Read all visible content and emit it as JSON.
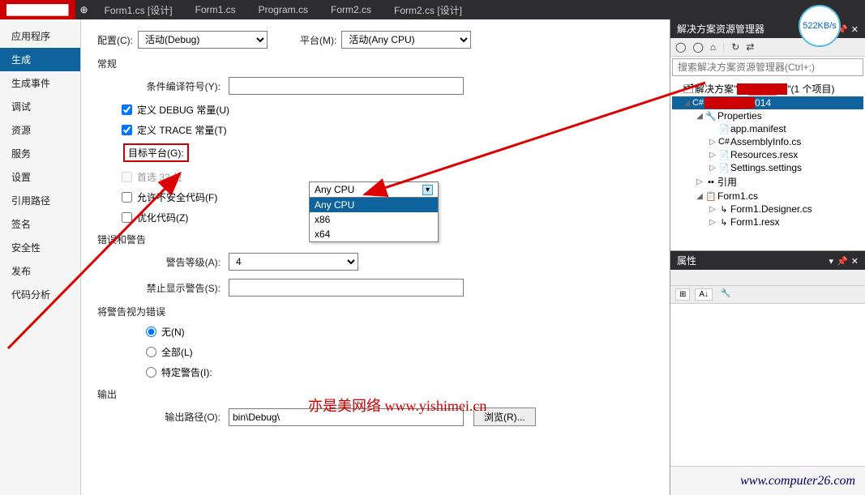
{
  "tabs": {
    "pinned_redacted": "█████████",
    "items": [
      "Form1.cs [设计]",
      "Form1.cs",
      "Program.cs",
      "Form2.cs",
      "Form2.cs [设计]"
    ]
  },
  "sidebar": {
    "items": [
      "应用程序",
      "生成",
      "生成事件",
      "调试",
      "资源",
      "服务",
      "设置",
      "引用路径",
      "签名",
      "安全性",
      "发布",
      "代码分析"
    ],
    "selected_index": 1
  },
  "config": {
    "config_label": "配置(C):",
    "config_value": "活动(Debug)",
    "platform_label": "平台(M):",
    "platform_value": "活动(Any CPU)"
  },
  "general": {
    "header": "常规",
    "cond_symbol_label": "条件编译符号(Y):",
    "cond_symbol_value": "",
    "define_debug": "定义 DEBUG 常量(U)",
    "define_trace": "定义 TRACE 常量(T)",
    "target_platform_label": "目标平台(G):",
    "target_platform_value": "Any CPU",
    "target_options": [
      "Any CPU",
      "x86",
      "x64"
    ],
    "prefer32_label": "首选 32 位",
    "unsafe_label": "允许不安全代码(F)",
    "optimize_label": "优化代码(Z)"
  },
  "warnings": {
    "header": "错误和警告",
    "level_label": "警告等级(A):",
    "level_value": "4",
    "suppress_label": "禁止显示警告(S):",
    "suppress_value": ""
  },
  "treat_as_error": {
    "header": "将警告视为错误",
    "none": "无(N)",
    "all": "全部(L)",
    "specific": "特定警告(I):"
  },
  "output": {
    "header": "输出",
    "path_label": "输出路径(O):",
    "path_value": "bin\\Debug\\",
    "browse": "浏览(R)..."
  },
  "solution_explorer": {
    "title": "解决方案资源管理器",
    "search_placeholder": "搜索解决方案资源管理器(Ctrl+;)",
    "solution_prefix": "解决方案\"",
    "solution_redacted": "████",
    "solution_suffix": "\"(1 个项目)",
    "proj_redacted": "████",
    "proj_suffix": "014",
    "nodes": {
      "properties": "Properties",
      "app_manifest": "app.manifest",
      "assembly_info": "AssemblyInfo.cs",
      "resources_resx": "Resources.resx",
      "settings_settings": "Settings.settings",
      "references": "引用",
      "form1_cs": "Form1.cs",
      "form1_designer": "Form1.Designer.cs",
      "form1_resx": "Form1.resx"
    }
  },
  "properties_panel": {
    "title": "属性"
  },
  "speed_badge": "522KB/s",
  "watermark": "亦是美网络 www.yishimei.cn",
  "watermark2": "www.computer26.com"
}
